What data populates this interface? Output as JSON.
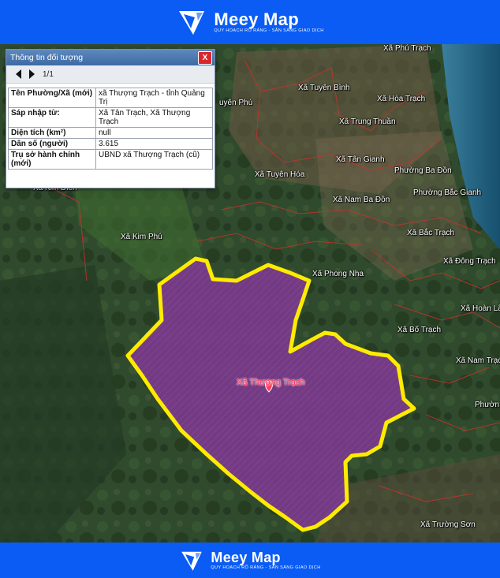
{
  "brand": {
    "name": "Meey Map",
    "tagline": "QUY HOẠCH RÕ RÀNG - SẴN SÀNG GIAO DỊCH",
    "logo_icon": "meey-logo-icon"
  },
  "panel": {
    "title": "Thông tin đối tượng",
    "close_label": "X",
    "pager": "1/1",
    "rows": [
      {
        "key": "Tên Phường/Xã (mới)",
        "value": "xã Thượng Trạch - tỉnh Quảng Trị"
      },
      {
        "key": "Sáp nhập từ:",
        "value": "Xã Tân Trạch, Xã Thượng Trạch"
      },
      {
        "key": "Diện tích (km²)",
        "value": "null"
      },
      {
        "key": "Dân số (người)",
        "value": "3.615"
      },
      {
        "key": "Trụ sở hành chính (mới)",
        "value": "UBND xã Thượng Trạch (cũ)"
      }
    ]
  },
  "map": {
    "selected_label": "Xã Thượng Trạch",
    "selected_color": "#7a3a8c",
    "boundary_color": "#ffeb00",
    "place_labels": [
      "Xã Phú Trạch",
      "Xã Tuyên Bình",
      "Xã Hòa Trạch",
      "uyên Phú",
      "Xã Trung Thuần",
      "Xã Tân Gianh",
      "Phường Ba Đồn",
      "Xã Tuyên Hóa",
      "Phường Bắc Gianh",
      "Xã Nam Ba Đồn",
      "Xã Kim Điền",
      "Xã Kim Phú",
      "Xã Bắc Trạch",
      "Xã Đông Trạch",
      "Xã Phong Nha",
      "Xã Hoàn Lão",
      "Xã Bố Trạch",
      "Xã Nam Trạch",
      "Phườn",
      "Xã Trường Sơn"
    ]
  }
}
